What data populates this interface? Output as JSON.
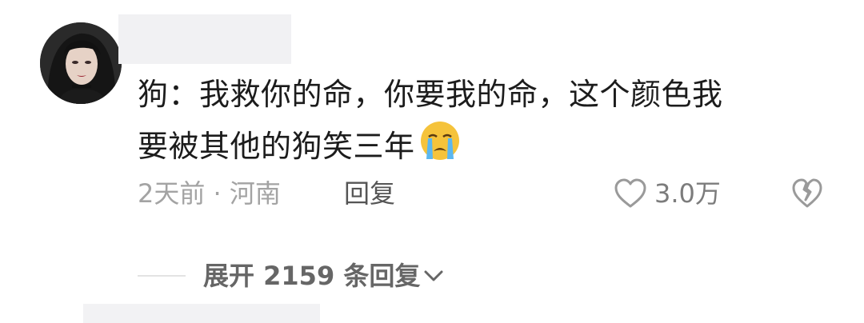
{
  "comment": {
    "line1": "狗：我救你的命，你要我的命，这个颜色我",
    "line2": "要被其他的狗笑三年",
    "emoji": "loudly-crying-face"
  },
  "meta": {
    "time_location": "2天前 · 河南",
    "reply_label": "回复"
  },
  "likes": {
    "count": "3.0万",
    "icon": "heart-outline-icon"
  },
  "dislike": {
    "icon": "broken-heart-icon"
  },
  "replies": {
    "expand_label": "展开 2159 条回复",
    "icon": "chevron-down-icon"
  },
  "colors": {
    "text": "#1c1c1c",
    "meta": "#a3a3a3",
    "secondary": "#666666",
    "redaction": "#f1f1f3"
  }
}
